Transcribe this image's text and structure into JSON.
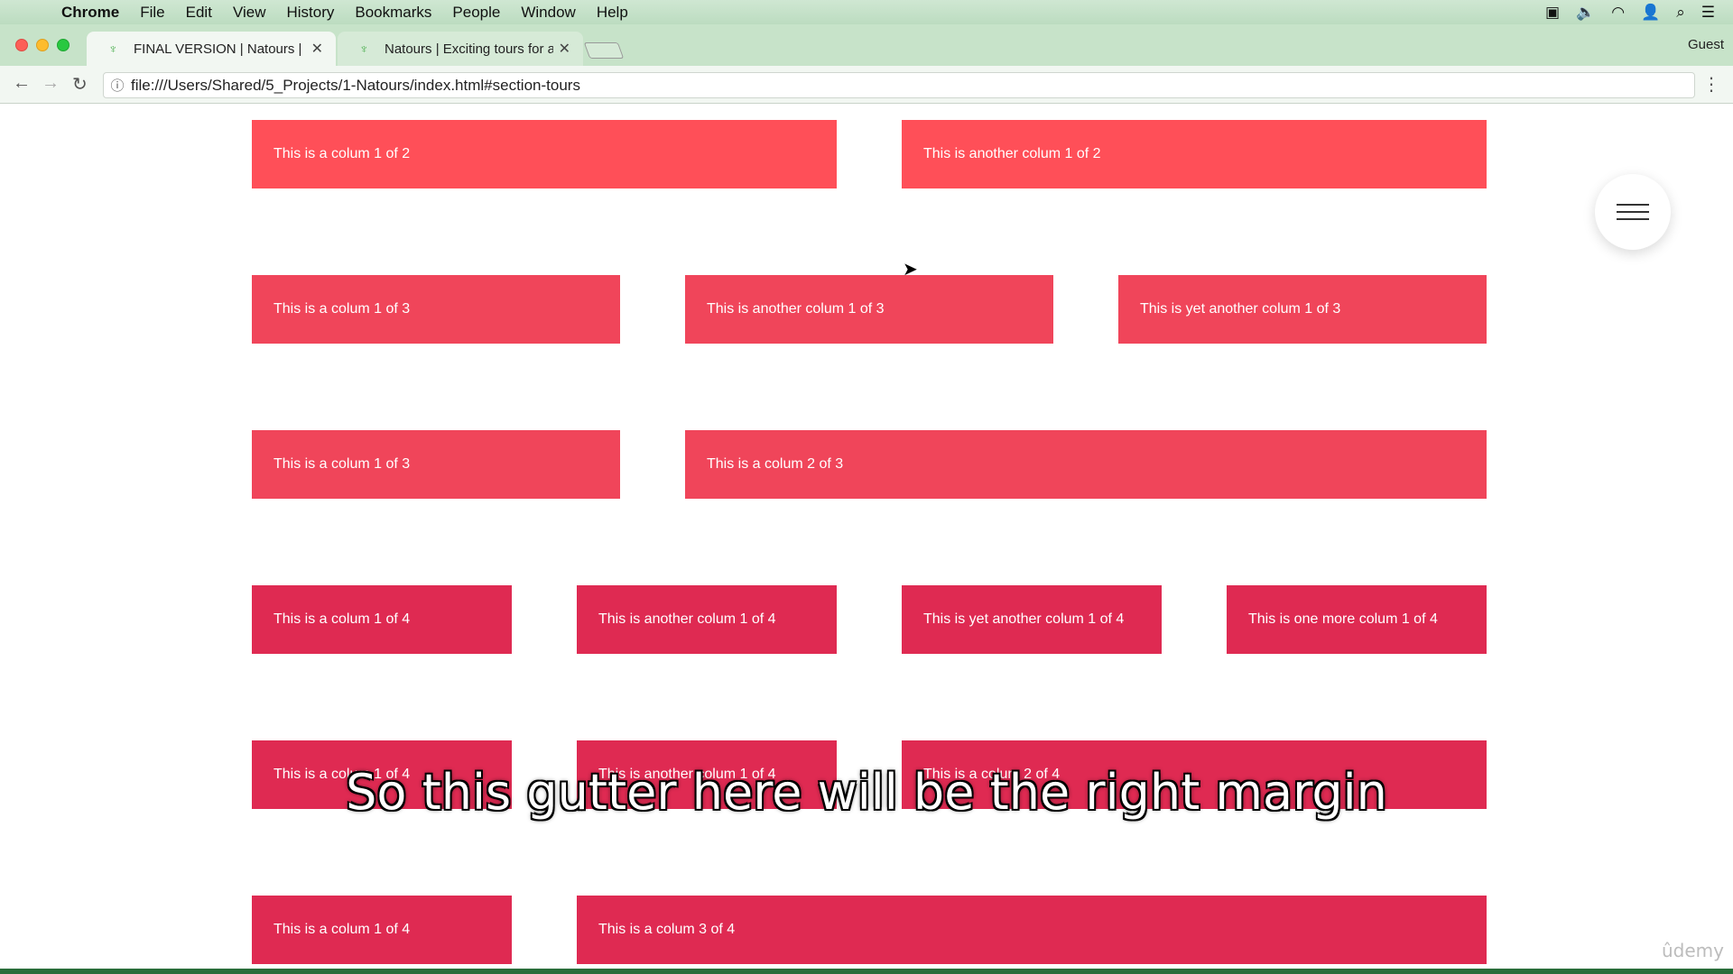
{
  "menubar": {
    "app_name": "Chrome",
    "items": [
      "File",
      "Edit",
      "View",
      "History",
      "Bookmarks",
      "People",
      "Window",
      "Help"
    ]
  },
  "tabs": [
    {
      "title": "FINAL VERSION | Natours | Exc",
      "active": true
    },
    {
      "title": "Natours | Exciting tours for adv",
      "active": false
    }
  ],
  "profile": "Guest",
  "address_bar": {
    "url": "file:///Users/Shared/5_Projects/1-Natours/index.html#section-tours"
  },
  "grid": {
    "rows": [
      {
        "cells": [
          "This is a colum 1 of 2",
          "This is another colum 1 of 2"
        ]
      },
      {
        "cells": [
          "This is a colum 1 of 3",
          "This is another colum 1 of 3",
          "This is yet another colum 1 of 3"
        ]
      },
      {
        "cells": [
          "This is a colum 1 of 3",
          "This is a colum 2 of 3"
        ]
      },
      {
        "cells": [
          "This is a colum 1 of 4",
          "This is another colum 1 of 4",
          "This is yet another colum 1 of 4",
          "This is one more colum 1 of 4"
        ]
      },
      {
        "cells": [
          "This is a colum 1 of 4",
          "This is another colum 1 of 4",
          "This is a colum 2 of 4"
        ]
      },
      {
        "cells": [
          "This is a colum 1 of 4",
          "This is a colum 3 of 4"
        ]
      }
    ]
  },
  "caption": "So this gutter here will be the right margin",
  "watermark": "ûdemy",
  "colors": {
    "row_2col": "#ff4f58",
    "row_3col": "#f0455a",
    "row_4col": "#df2a52"
  }
}
